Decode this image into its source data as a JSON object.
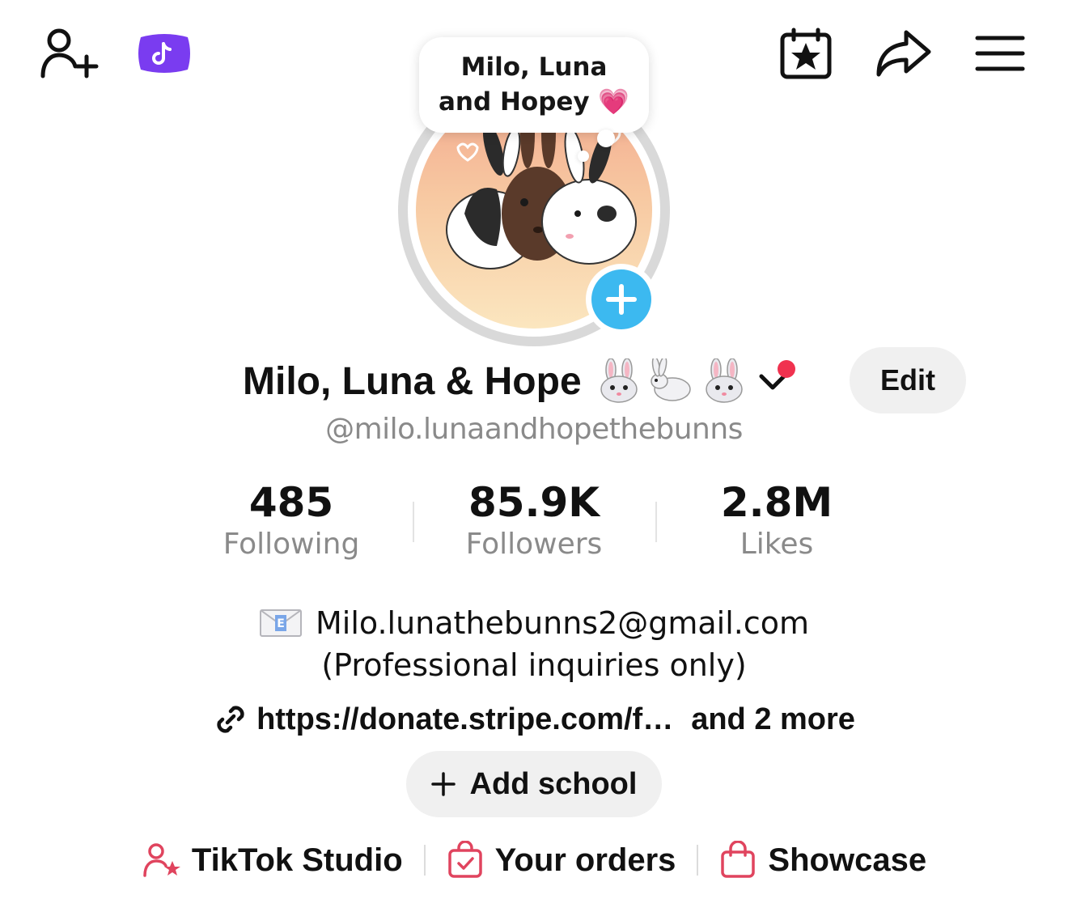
{
  "note": {
    "text": "Milo, Luna and Hopey 💗"
  },
  "profile": {
    "display_name": "Milo, Luna & Hope",
    "username": "@milo.lunaandhopethebunns",
    "edit_label": "Edit"
  },
  "stats": [
    {
      "value": "485",
      "label": "Following"
    },
    {
      "value": "85.9K",
      "label": "Followers"
    },
    {
      "value": "2.8M",
      "label": "Likes"
    }
  ],
  "bio": {
    "email": "Milo.lunathebunns2@gmail.com",
    "note": "(Professional inquiries only)"
  },
  "link": {
    "url": "https://donate.stripe.com/f…",
    "more": "and 2 more"
  },
  "add_school_label": "Add school",
  "bottom_links": [
    {
      "label": "TikTok Studio",
      "icon": "person-star-icon"
    },
    {
      "label": "Your orders",
      "icon": "order-bag-icon"
    },
    {
      "label": "Showcase",
      "icon": "shopping-bag-icon"
    }
  ],
  "colors": {
    "accent_blue": "#3cb9f0",
    "badge_purple": "#7a3cf0",
    "notification_red": "#f0324f",
    "icon_pink": "#e0445e"
  },
  "icons": [
    "add-friend-icon",
    "tiktok-badge-icon",
    "calendar-star-icon",
    "share-icon",
    "menu-icon",
    "chevron-down-icon",
    "envelope-icon",
    "link-icon",
    "plus-icon"
  ]
}
